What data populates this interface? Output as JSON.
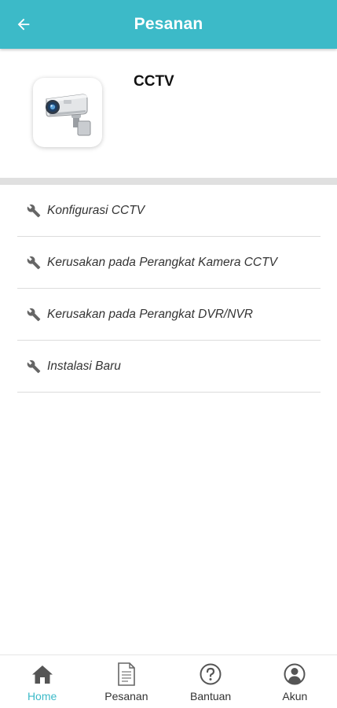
{
  "header": {
    "title": "Pesanan",
    "back_icon": "arrow-left-icon",
    "background": "#3cbac8"
  },
  "service": {
    "name": "CCTV",
    "thumbnail_icon": "cctv-camera-icon"
  },
  "menu": {
    "items": [
      {
        "label": "Konfigurasi CCTV",
        "icon": "wrench-icon"
      },
      {
        "label": "Kerusakan pada Perangkat Kamera CCTV",
        "icon": "wrench-icon"
      },
      {
        "label": "Kerusakan pada Perangkat DVR/NVR",
        "icon": "wrench-icon"
      },
      {
        "label": "Instalasi Baru",
        "icon": "wrench-icon"
      }
    ]
  },
  "bottom_nav": {
    "active": "Home",
    "items": [
      {
        "label": "Home",
        "icon": "home-icon"
      },
      {
        "label": "Pesanan",
        "icon": "document-icon"
      },
      {
        "label": "Bantuan",
        "icon": "help-circle-icon"
      },
      {
        "label": "Akun",
        "icon": "account-icon"
      }
    ]
  },
  "colors": {
    "accent": "#3cbac8",
    "text": "#333333",
    "divider": "#e0e0e0"
  }
}
